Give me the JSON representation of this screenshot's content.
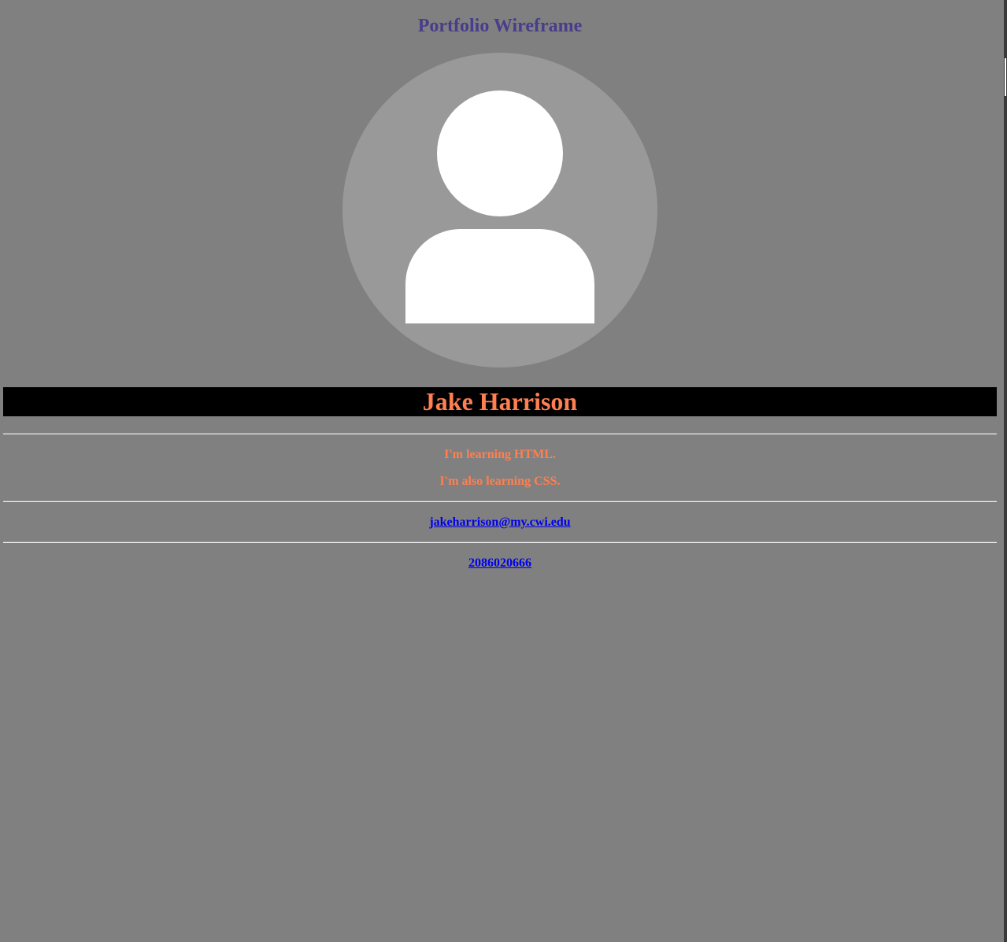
{
  "page": {
    "title": "Portfolio Wireframe"
  },
  "profile": {
    "avatar_icon": "user-silhouette-icon",
    "name": "Jake Harrison"
  },
  "about": {
    "lines": [
      "I'm learning HTML.",
      "I'm also learning CSS."
    ]
  },
  "contact": {
    "email": "jakeharrison@my.cwi.edu",
    "email_href": "mailto:jakeharrison@my.cwi.edu",
    "phone": "2086020666",
    "phone_href": "tel:2086020666"
  },
  "colors": {
    "background": "#808080",
    "title": "#483d8b",
    "accent": "#ff7f50",
    "banner": "#000000",
    "link": "#0000ee",
    "avatar_circle": "#999999",
    "avatar_figure": "#ffffff"
  }
}
